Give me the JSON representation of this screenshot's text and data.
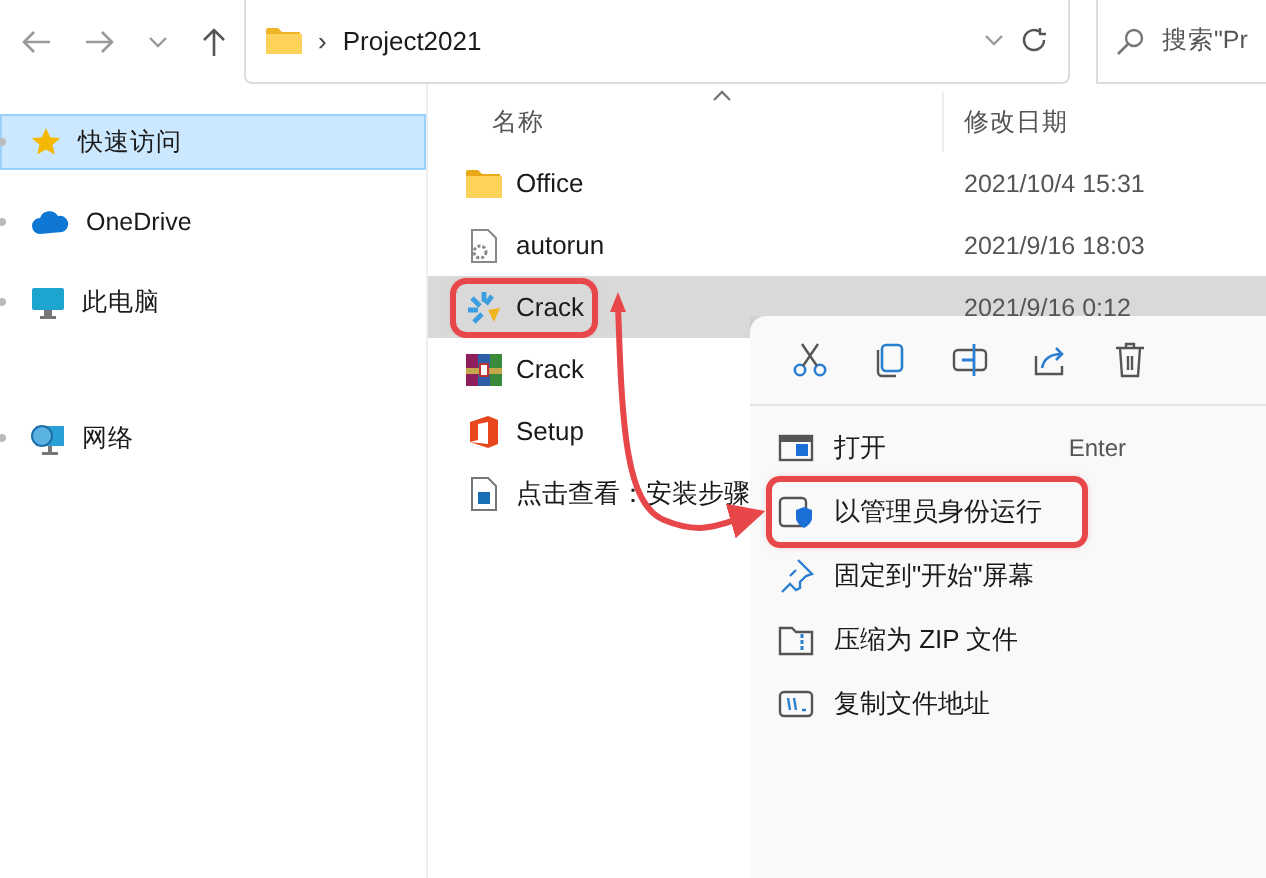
{
  "toolbar": {
    "path_separator": "›",
    "path": "Project2021",
    "search_placeholder": "搜索\"Pr"
  },
  "nav": [
    {
      "label": "快速访问",
      "kind": "star",
      "selected": true
    },
    {
      "label": "OneDrive",
      "kind": "cloud",
      "selected": false
    },
    {
      "label": "此电脑",
      "kind": "pc",
      "selected": false
    },
    {
      "label": "网络",
      "kind": "network",
      "selected": false
    }
  ],
  "columns": [
    "名称",
    "修改日期"
  ],
  "files": [
    {
      "name": "Office",
      "kind": "folder",
      "date": "2021/10/4 15:31",
      "selected": false,
      "annotated": false
    },
    {
      "name": "autorun",
      "kind": "settings-file",
      "date": "2021/9/16 18:03",
      "selected": false,
      "annotated": false
    },
    {
      "name": "Crack",
      "kind": "app",
      "date": "2021/9/16 0:12",
      "selected": true,
      "annotated": true
    },
    {
      "name": "Crack",
      "kind": "archive",
      "selected": false,
      "annotated": false
    },
    {
      "name": "Setup",
      "kind": "office",
      "selected": false,
      "annotated": false
    },
    {
      "name": "点击查看：安装步骤",
      "kind": "image-file",
      "selected": false,
      "annotated": false
    }
  ],
  "context_menu": {
    "actions": [
      {
        "kind": "cut"
      },
      {
        "kind": "copy"
      },
      {
        "kind": "rename"
      },
      {
        "kind": "share"
      },
      {
        "kind": "delete"
      }
    ],
    "items": [
      {
        "label": "打开",
        "kind": "open",
        "shortcut": "Enter",
        "annotated": false
      },
      {
        "label": "以管理员身份运行",
        "kind": "admin",
        "annotated": true
      },
      {
        "label": "固定到\"开始\"屏幕",
        "kind": "pin",
        "annotated": false
      },
      {
        "label": "压缩为 ZIP 文件",
        "kind": "zip",
        "annotated": false
      },
      {
        "label": "复制文件地址",
        "kind": "path",
        "annotated": false
      }
    ]
  }
}
